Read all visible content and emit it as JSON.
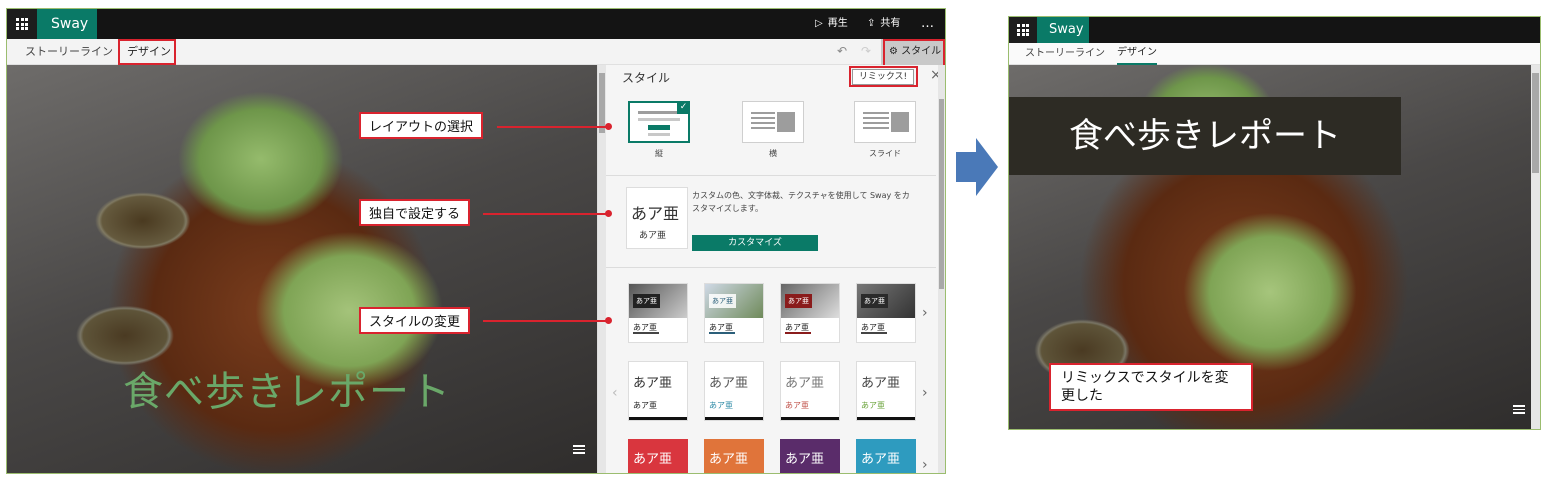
{
  "app": {
    "name": "Sway"
  },
  "toolbar": {
    "play_label": "再生",
    "share_label": "共有",
    "more_label": "…",
    "style_label": "スタイル"
  },
  "tabs": {
    "storyline": "ストーリーライン",
    "design": "デザイン"
  },
  "canvas": {
    "title_text": "食べ歩きレポート"
  },
  "panel": {
    "title": "スタイル",
    "remix_label": "リミックス!",
    "close_label": "×",
    "layouts": [
      {
        "label": "縦",
        "selected": true
      },
      {
        "label": "横",
        "selected": false
      },
      {
        "label": "スライド",
        "selected": false
      }
    ],
    "customize": {
      "preview_big": "あア亜",
      "preview_small": "あア亜",
      "description": "カスタムの色、文字体裁、テクスチャを使用して Sway をカスタマイズします。",
      "button_label": "カスタマイズ"
    },
    "style_sample_big": "あア亜",
    "style_sample_small": "あア亜",
    "style_row1_colors": [
      "#222222",
      "#2b5f7a",
      "#8a1c1c",
      "#2a2a2a"
    ],
    "style_row2_accents": [
      "#333333",
      "#2d8aa6",
      "#c0524a",
      "#6aa33a"
    ],
    "style_row3_colors": [
      "#d9363e",
      "#e0743a",
      "#5a2c6a",
      "#2e9bbf"
    ]
  },
  "callouts": {
    "layout": "レイアウトの選択",
    "custom": "独自で設定する",
    "style": "スタイルの変更"
  },
  "result": {
    "tabs": {
      "storyline": "ストーリーライン",
      "design": "デザイン"
    },
    "title_text": "食べ歩きレポート",
    "note": "リミックスでスタイルを変更した"
  },
  "colors": {
    "brand": "#0a7a67",
    "highlight": "#d9232e",
    "arrow": "#4a79b8"
  }
}
